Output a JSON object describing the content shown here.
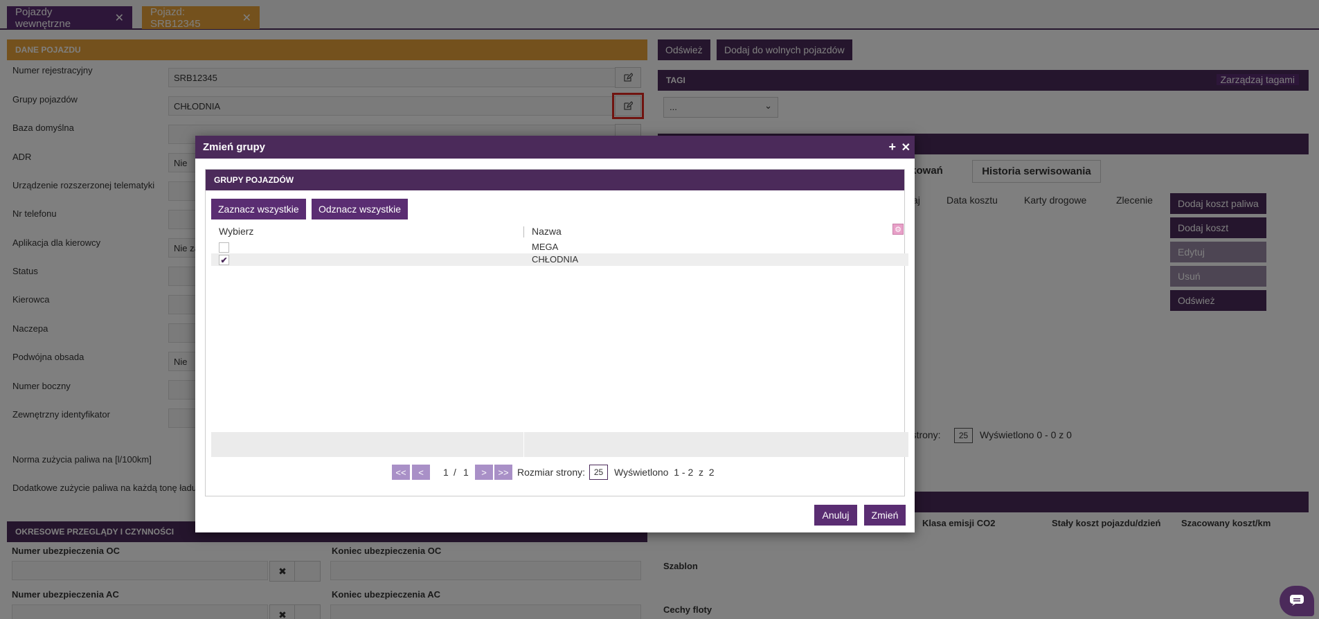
{
  "tabs": [
    {
      "label": "Pojazdy wewnętrzne"
    },
    {
      "label": "Pojazd: SRB12345"
    }
  ],
  "vehicle": {
    "header": "DANE POJAZDU",
    "fields": [
      {
        "label": "Numer rejestracyjny",
        "value": "SRB12345"
      },
      {
        "label": "Grupy pojazdów",
        "value": "CHŁODNIA"
      },
      {
        "label": "Baza domyślna",
        "value": ""
      },
      {
        "label": "ADR",
        "value": "Nie"
      },
      {
        "label": "Urządzenie rozszerzonej telematyki",
        "value": ""
      },
      {
        "label": "Nr telefonu",
        "value": ""
      },
      {
        "label": "Aplikacja dla kierowcy",
        "value": "Nie zał"
      },
      {
        "label": "Status",
        "value": ""
      },
      {
        "label": "Kierowca",
        "value": ""
      },
      {
        "label": "Naczepa",
        "value": ""
      },
      {
        "label": "Podwójna obsada",
        "value": "Nie"
      },
      {
        "label": "Numer boczny",
        "value": ""
      },
      {
        "label": "Zewnętrzny identyfikator",
        "value": ""
      },
      {
        "label": "Norma zużycia paliwa na [l/100km]",
        "value": ""
      },
      {
        "label": "Dodatkowe zużycie paliwa na każdą tonę ładu",
        "value": ""
      }
    ]
  },
  "inspections": {
    "header": "OKRESOWE PRZEGLĄDY I CZYNNOŚCI",
    "oc_number": "Numer ubezpieczenia OC",
    "oc_end": "Koniec ubezpieczenia OC",
    "ac_number": "Numer ubezpieczenia AC",
    "ac_end": "Koniec ubezpieczenia AC"
  },
  "right": {
    "refresh": "Odśwież",
    "add_free": "Dodaj do wolnych pojazdów",
    "tags_header": "TAGI",
    "manage_tags": "Zarządzaj tagami",
    "tags_select": "...",
    "tab_partial": "nkowań",
    "tab_service": "Historia serwisowania",
    "cols": [
      "aj",
      "Data kosztu",
      "Karty drogowe",
      "Zlecenie"
    ],
    "add_fuel_cost": "Dodaj koszt paliwa",
    "add_cost": "Dodaj koszt",
    "edit": "Edytuj",
    "delete": "Usuń",
    "refresh2": "Odśwież",
    "pager_text": "r strony:",
    "pager_size": "25",
    "pager_shown": "Wyświetlono  0 - 0  z  0",
    "co2_class": "Klasa emisji CO2",
    "fixed_cost": "Stały koszt pojazdu/dzień",
    "est_cost": "Szacowany koszt/km",
    "template": "Szablon",
    "fleet": "Cechy floty"
  },
  "modal": {
    "title": "Zmień grupy",
    "section": "GRUPY POJAZDÓW",
    "select_all": "Zaznacz wszystkie",
    "deselect_all": "Odznacz wszystkie",
    "col_select": "Wybierz",
    "col_name": "Nazwa",
    "rows": [
      {
        "name": "MEGA",
        "checked": false
      },
      {
        "name": "CHŁODNIA",
        "checked": true
      }
    ],
    "pager": {
      "first": "<<",
      "prev": "<",
      "page": "1",
      "sep": "/",
      "total": "1",
      "next": ">",
      "last": ">>",
      "size_label": "Rozmiar strony:",
      "size": "25",
      "shown": "Wyświetlono  1 - 2  z  2"
    },
    "cancel": "Anuluj",
    "change": "Zmień"
  },
  "colors": {
    "purple": "#4b2a5a",
    "orange": "#e8a33a",
    "highlight": "#e0271f"
  }
}
